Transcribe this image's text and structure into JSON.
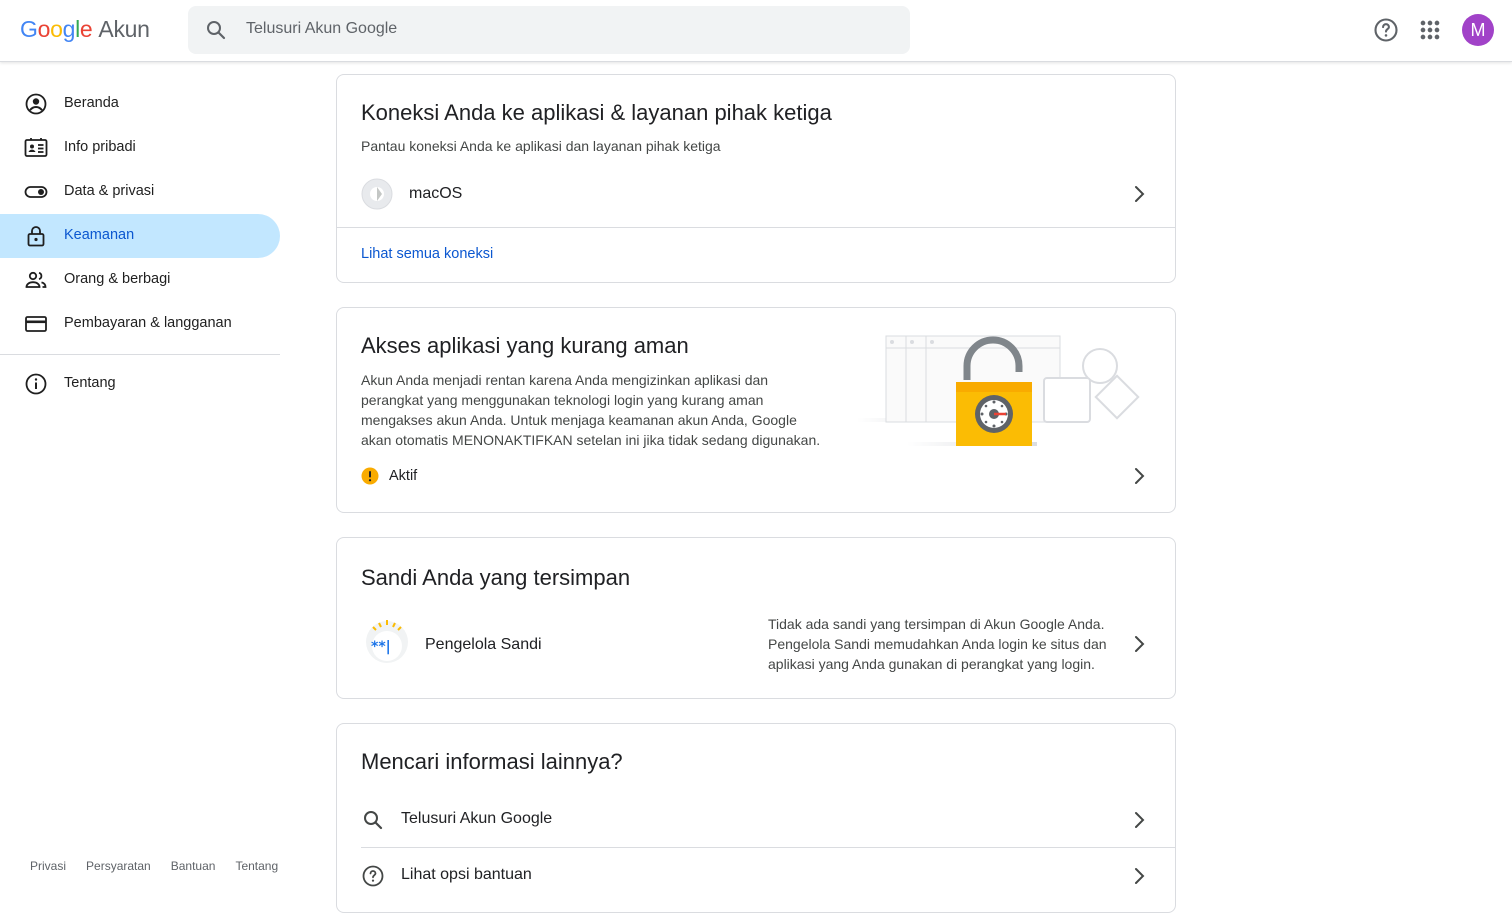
{
  "header": {
    "logo_google": "Google",
    "logo_product": "Akun",
    "search_placeholder": "Telusuri Akun Google",
    "avatar_letter": "M",
    "avatar_color": "#a142c8"
  },
  "sidebar": {
    "items": [
      {
        "label": "Beranda",
        "icon": "account-circle-icon"
      },
      {
        "label": "Info pribadi",
        "icon": "id-card-icon"
      },
      {
        "label": "Data & privasi",
        "icon": "toggle-icon"
      },
      {
        "label": "Keamanan",
        "icon": "lock-icon",
        "active": true
      },
      {
        "label": "Orang & berbagi",
        "icon": "people-icon"
      },
      {
        "label": "Pembayaran & langganan",
        "icon": "credit-card-icon"
      },
      {
        "label": "Tentang",
        "icon": "info-icon"
      }
    ],
    "footer": [
      "Privasi",
      "Persyaratan",
      "Bantuan",
      "Tentang"
    ]
  },
  "connections_card": {
    "title": "Koneksi Anda ke aplikasi & layanan pihak ketiga",
    "subtitle": "Pantau koneksi Anda ke aplikasi dan layanan pihak ketiga",
    "app_name": "macOS",
    "link": "Lihat semua koneksi"
  },
  "less_secure_card": {
    "title": "Akses aplikasi yang kurang aman",
    "description": "Akun Anda menjadi rentan karena Anda mengizinkan aplikasi dan perangkat yang menggunakan teknologi login yang kurang aman mengakses akun Anda. Untuk menjaga keamanan akun Anda, Google akan otomatis MENONAKTIFKAN setelan ini jika tidak sedang digunakan.",
    "status": "Aktif",
    "status_color": "#f9ab00"
  },
  "passwords_card": {
    "title": "Sandi Anda yang tersimpan",
    "manager_label": "Pengelola Sandi",
    "manager_glyph": "**|",
    "description": "Tidak ada sandi yang tersimpan di Akun Google Anda. Pengelola Sandi memudahkan Anda login ke situs dan aplikasi yang Anda gunakan di perangkat yang login."
  },
  "more_info_card": {
    "title": "Mencari informasi lainnya?",
    "items": [
      {
        "label": "Telusuri Akun Google",
        "icon": "search-icon"
      },
      {
        "label": "Lihat opsi bantuan",
        "icon": "help-icon"
      }
    ]
  },
  "colors": {
    "accent": "#0b57d0",
    "active_bg": "#c2e7ff",
    "link": "#0b57d0"
  }
}
